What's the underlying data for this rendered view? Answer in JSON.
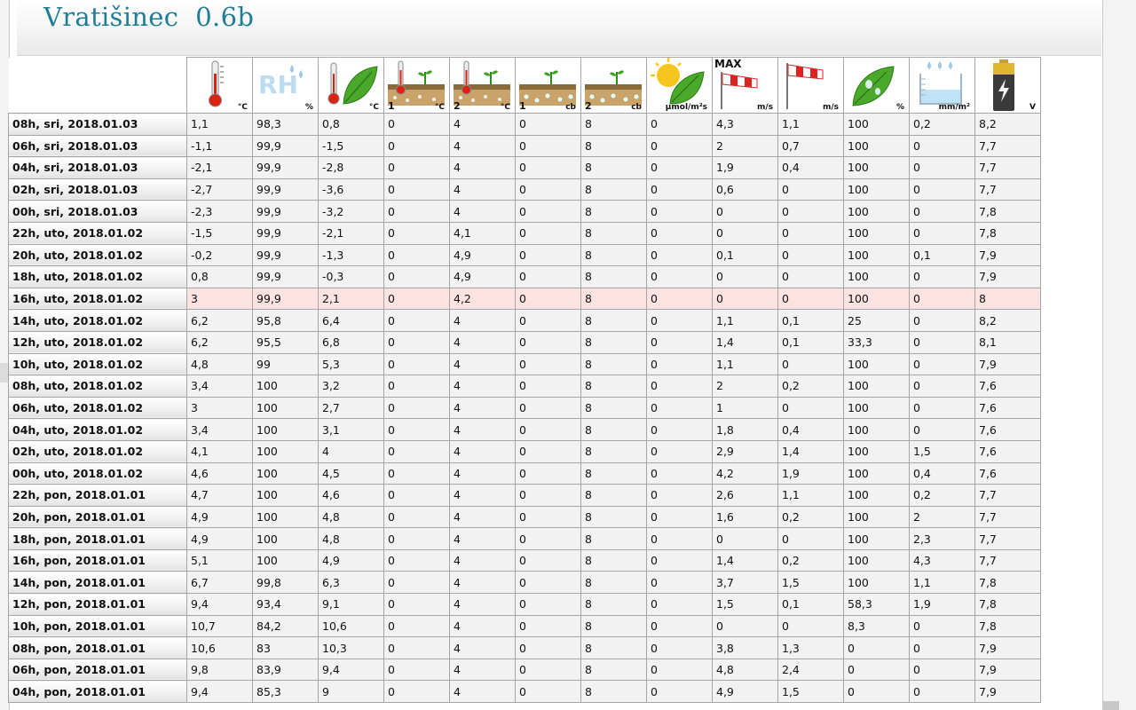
{
  "page": {
    "title": "Vratišinec  0.6b"
  },
  "colors": {
    "title": "#1f7e96",
    "highlight_row": "#fde2e2"
  },
  "columns": [
    {
      "icon": "air-temperature-icon",
      "unit": "°C"
    },
    {
      "icon": "relative-humidity-icon",
      "unit": "%"
    },
    {
      "icon": "leaf-temperature-icon",
      "unit": "°C"
    },
    {
      "icon": "soil-temperature-1-icon",
      "num": "1",
      "unit": "°C"
    },
    {
      "icon": "soil-temperature-2-icon",
      "num": "2",
      "unit": "°C"
    },
    {
      "icon": "soil-moisture-1-icon",
      "num": "1",
      "unit": "cb"
    },
    {
      "icon": "soil-moisture-2-icon",
      "num": "2",
      "unit": "cb"
    },
    {
      "icon": "solar-radiation-icon",
      "unit": "µmol/m²s"
    },
    {
      "icon": "max-wind-speed-icon",
      "max": "MAX",
      "unit": "m/s"
    },
    {
      "icon": "wind-speed-icon",
      "unit": "m/s"
    },
    {
      "icon": "leaf-wetness-icon",
      "unit": "%"
    },
    {
      "icon": "precipitation-icon",
      "unit": "mm/m²"
    },
    {
      "icon": "battery-icon",
      "unit": "V"
    }
  ],
  "rows": [
    {
      "label": "08h, sri, 2018.01.03",
      "values": [
        "1,1",
        "98,3",
        "0,8",
        "0",
        "4",
        "0",
        "8",
        "0",
        "4,3",
        "1,1",
        "100",
        "0,2",
        "8,2"
      ]
    },
    {
      "label": "06h, sri, 2018.01.03",
      "values": [
        "-1,1",
        "99,9",
        "-1,5",
        "0",
        "4",
        "0",
        "8",
        "0",
        "2",
        "0,7",
        "100",
        "0",
        "7,7"
      ]
    },
    {
      "label": "04h, sri, 2018.01.03",
      "values": [
        "-2,1",
        "99,9",
        "-2,8",
        "0",
        "4",
        "0",
        "8",
        "0",
        "1,9",
        "0,4",
        "100",
        "0",
        "7,7"
      ]
    },
    {
      "label": "02h, sri, 2018.01.03",
      "values": [
        "-2,7",
        "99,9",
        "-3,6",
        "0",
        "4",
        "0",
        "8",
        "0",
        "0,6",
        "0",
        "100",
        "0",
        "7,7"
      ]
    },
    {
      "label": "00h, sri, 2018.01.03",
      "values": [
        "-2,3",
        "99,9",
        "-3,2",
        "0",
        "4",
        "0",
        "8",
        "0",
        "0",
        "0",
        "100",
        "0",
        "7,8"
      ]
    },
    {
      "label": "22h, uto, 2018.01.02",
      "values": [
        "-1,5",
        "99,9",
        "-2,1",
        "0",
        "4,1",
        "0",
        "8",
        "0",
        "0",
        "0",
        "100",
        "0",
        "7,8"
      ]
    },
    {
      "label": "20h, uto, 2018.01.02",
      "values": [
        "-0,2",
        "99,9",
        "-1,3",
        "0",
        "4,9",
        "0",
        "8",
        "0",
        "0,1",
        "0",
        "100",
        "0,1",
        "7,9"
      ]
    },
    {
      "label": "18h, uto, 2018.01.02",
      "values": [
        "0,8",
        "99,9",
        "-0,3",
        "0",
        "4,9",
        "0",
        "8",
        "0",
        "0",
        "0",
        "100",
        "0",
        "7,9"
      ]
    },
    {
      "label": "16h, uto, 2018.01.02",
      "highlight": true,
      "values": [
        "3",
        "99,9",
        "2,1",
        "0",
        "4,2",
        "0",
        "8",
        "0",
        "0",
        "0",
        "100",
        "0",
        "8"
      ]
    },
    {
      "label": "14h, uto, 2018.01.02",
      "values": [
        "6,2",
        "95,8",
        "6,4",
        "0",
        "4",
        "0",
        "8",
        "0",
        "1,1",
        "0,1",
        "25",
        "0",
        "8,2"
      ]
    },
    {
      "label": "12h, uto, 2018.01.02",
      "values": [
        "6,2",
        "95,5",
        "6,8",
        "0",
        "4",
        "0",
        "8",
        "0",
        "1,4",
        "0,1",
        "33,3",
        "0",
        "8,1"
      ]
    },
    {
      "label": "10h, uto, 2018.01.02",
      "values": [
        "4,8",
        "99",
        "5,3",
        "0",
        "4",
        "0",
        "8",
        "0",
        "1,1",
        "0",
        "100",
        "0",
        "7,9"
      ]
    },
    {
      "label": "08h, uto, 2018.01.02",
      "values": [
        "3,4",
        "100",
        "3,2",
        "0",
        "4",
        "0",
        "8",
        "0",
        "2",
        "0,2",
        "100",
        "0",
        "7,6"
      ]
    },
    {
      "label": "06h, uto, 2018.01.02",
      "values": [
        "3",
        "100",
        "2,7",
        "0",
        "4",
        "0",
        "8",
        "0",
        "1",
        "0",
        "100",
        "0",
        "7,6"
      ]
    },
    {
      "label": "04h, uto, 2018.01.02",
      "values": [
        "3,4",
        "100",
        "3,1",
        "0",
        "4",
        "0",
        "8",
        "0",
        "1,8",
        "0,4",
        "100",
        "0",
        "7,6"
      ]
    },
    {
      "label": "02h, uto, 2018.01.02",
      "values": [
        "4,1",
        "100",
        "4",
        "0",
        "4",
        "0",
        "8",
        "0",
        "2,9",
        "1,4",
        "100",
        "1,5",
        "7,6"
      ]
    },
    {
      "label": "00h, uto, 2018.01.02",
      "values": [
        "4,6",
        "100",
        "4,5",
        "0",
        "4",
        "0",
        "8",
        "0",
        "4,2",
        "1,9",
        "100",
        "0,4",
        "7,6"
      ]
    },
    {
      "label": "22h, pon, 2018.01.01",
      "values": [
        "4,7",
        "100",
        "4,6",
        "0",
        "4",
        "0",
        "8",
        "0",
        "2,6",
        "1,1",
        "100",
        "0,2",
        "7,7"
      ]
    },
    {
      "label": "20h, pon, 2018.01.01",
      "values": [
        "4,9",
        "100",
        "4,8",
        "0",
        "4",
        "0",
        "8",
        "0",
        "1,6",
        "0,2",
        "100",
        "2",
        "7,7"
      ]
    },
    {
      "label": "18h, pon, 2018.01.01",
      "values": [
        "4,9",
        "100",
        "4,8",
        "0",
        "4",
        "0",
        "8",
        "0",
        "0",
        "0",
        "100",
        "2,3",
        "7,7"
      ]
    },
    {
      "label": "16h, pon, 2018.01.01",
      "values": [
        "5,1",
        "100",
        "4,9",
        "0",
        "4",
        "0",
        "8",
        "0",
        "1,4",
        "0,2",
        "100",
        "4,3",
        "7,7"
      ]
    },
    {
      "label": "14h, pon, 2018.01.01",
      "values": [
        "6,7",
        "99,8",
        "6,3",
        "0",
        "4",
        "0",
        "8",
        "0",
        "3,7",
        "1,5",
        "100",
        "1,1",
        "7,8"
      ]
    },
    {
      "label": "12h, pon, 2018.01.01",
      "values": [
        "9,4",
        "93,4",
        "9,1",
        "0",
        "4",
        "0",
        "8",
        "0",
        "1,5",
        "0,1",
        "58,3",
        "1,9",
        "7,8"
      ]
    },
    {
      "label": "10h, pon, 2018.01.01",
      "values": [
        "10,7",
        "84,2",
        "10,6",
        "0",
        "4",
        "0",
        "8",
        "0",
        "0",
        "0",
        "8,3",
        "0",
        "7,8"
      ]
    },
    {
      "label": "08h, pon, 2018.01.01",
      "values": [
        "10,6",
        "83",
        "10,3",
        "0",
        "4",
        "0",
        "8",
        "0",
        "3,8",
        "1,3",
        "0",
        "0",
        "7,9"
      ]
    },
    {
      "label": "06h, pon, 2018.01.01",
      "values": [
        "9,8",
        "83,9",
        "9,4",
        "0",
        "4",
        "0",
        "8",
        "0",
        "4,8",
        "2,4",
        "0",
        "0",
        "7,9"
      ]
    },
    {
      "label": "04h, pon, 2018.01.01",
      "values": [
        "9,4",
        "85,3",
        "9",
        "0",
        "4",
        "0",
        "8",
        "0",
        "4,9",
        "1,5",
        "0",
        "0",
        "7,9"
      ]
    }
  ]
}
